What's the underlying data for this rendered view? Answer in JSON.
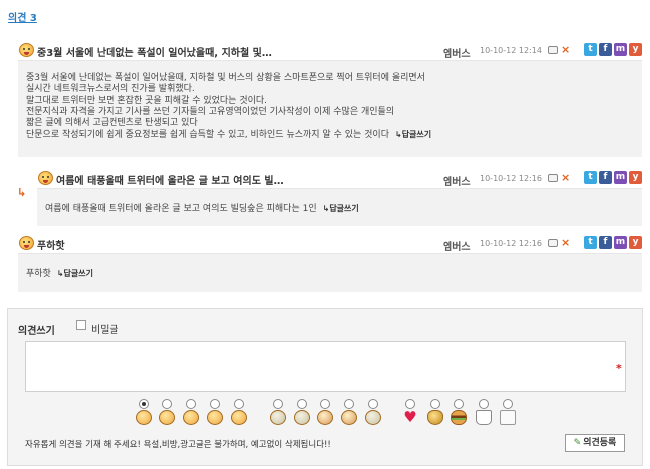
{
  "section": {
    "title": "의견 3"
  },
  "comments": [
    {
      "title": "중3월 서울에 난데없는 폭설이 일어났을때, 지하철 및…",
      "author": "엠버스",
      "date": "10-10-12 12:14",
      "body_lines": [
        "중3월 서울에 난데없는 폭설이 일어났을때, 지하철 및 버스의 상황을 스마트폰으로 찍어 트위터에 올리면서",
        "실시간 네트워크뉴스로서의 진가를 발휘했다.",
        "말그대로 트위터만 보면 혼잡한 곳을 피해갈 수 있었다는 것이다.",
        "전문지식과 자격을 가지고 기사를 쓰던 기자들의 고유영역이었던 기사작성이 이제 수많은 개인들의",
        "짧은 글에 의해서 고급컨텐츠로 탄생되고 있다",
        "단문으로 작성되기에 쉽게 중요정보를 쉽게 습득할 수 있고, 비하인드 뉴스까지 알 수 있는 것이다"
      ],
      "reply_label": "↳답글쓰기"
    },
    {
      "title": "여름에 태풍올때 트위터에 올라온 글 보고 여의도 빌…",
      "author": "엠버스",
      "date": "10-10-12 12:16",
      "body_lines": [
        "여름에 태풍올때 트위터에 올라온 글 보고 여의도 빌딩숲은 피해다는 1인"
      ],
      "reply_label": "↳답글쓰기"
    },
    {
      "title": "푸하핫",
      "author": "엠버스",
      "date": "10-10-12 12:16",
      "body_lines": [
        "푸하핫"
      ],
      "reply_label": "↳답글쓰기"
    }
  ],
  "reply_marker": "↳",
  "icons": {
    "edit": "edit-icon",
    "delete": "×",
    "twitter": "t",
    "facebook": "f",
    "me2day": "m",
    "yozm": "y"
  },
  "write_form": {
    "label": "의견쓰기",
    "secret_label": "비밀글",
    "required_mark": "*",
    "textarea_value": "",
    "selected_emoticon_index": 0,
    "emoticons": [
      "smile-face",
      "laugh-face",
      "grin-face",
      "shout-face",
      "ok-face",
      "curious-face",
      "cold-face",
      "angry-face",
      "sweat-face",
      "heart",
      "money-bag",
      "burger",
      "coffee-cup",
      "paper"
    ],
    "notice": "자유롭게 의견을 기재 해 주세요! 욕설,비방,광고글은 불가하며, 예고없이 삭제됩니다!!",
    "submit_label": "의견등록",
    "submit_icon": "✎"
  },
  "colors": {
    "title_blue": "#2a7bbf",
    "accent_orange": "#e2621b",
    "required_red": "#d21c1c"
  }
}
